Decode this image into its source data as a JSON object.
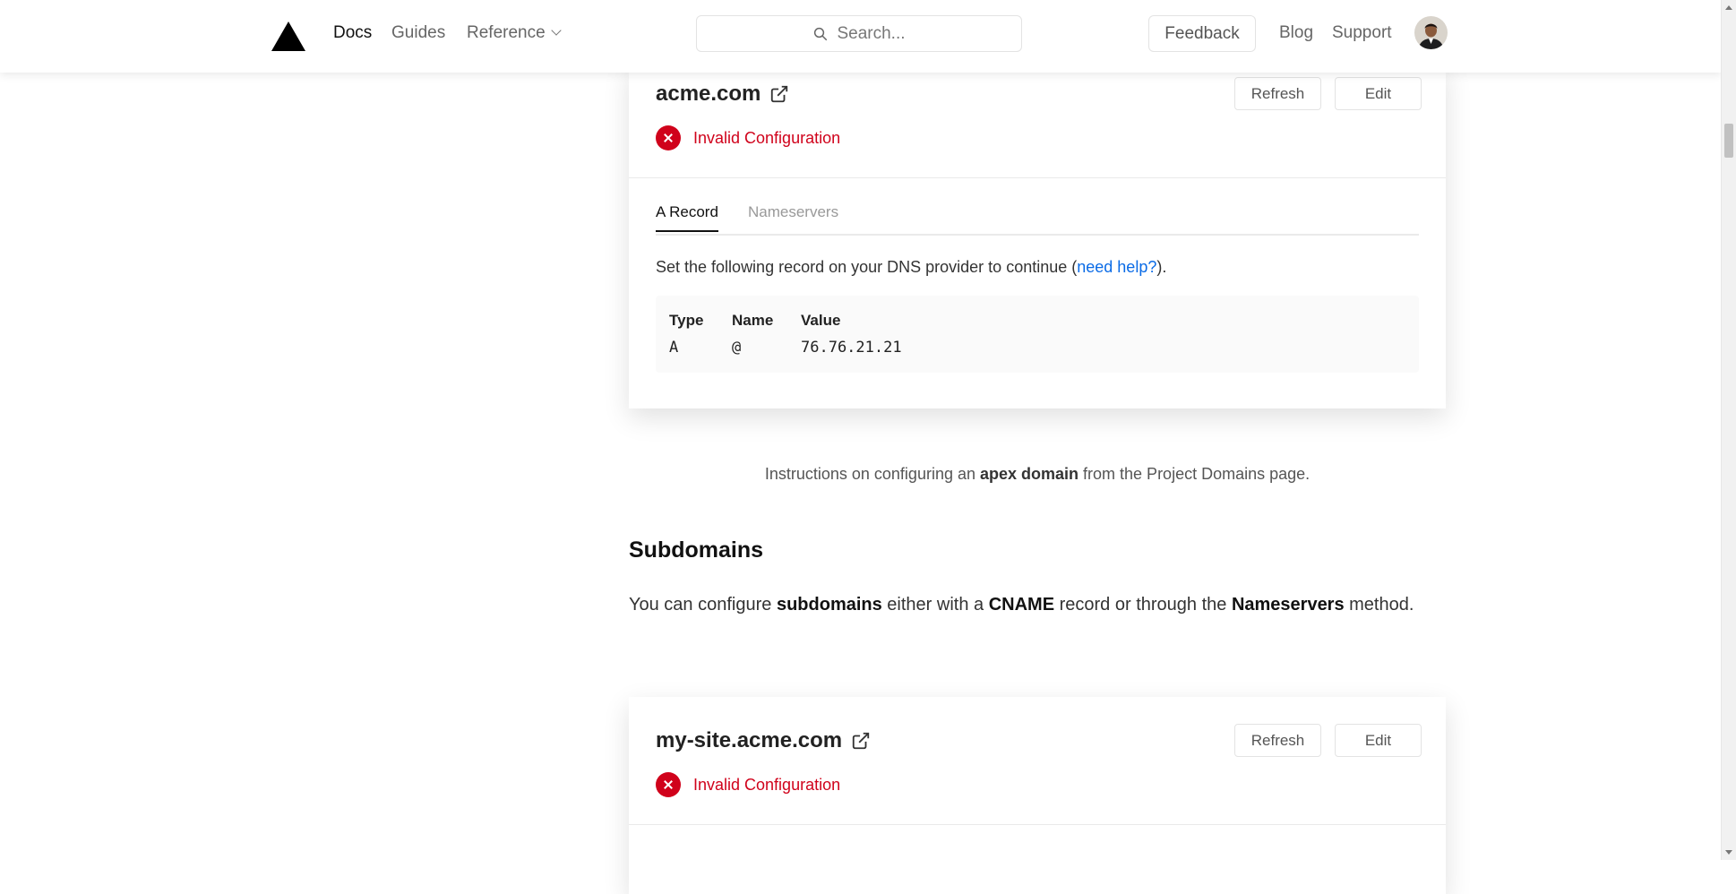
{
  "header": {
    "nav": [
      "Docs",
      "Guides",
      "Reference"
    ],
    "search_placeholder": "Search...",
    "feedback_label": "Feedback",
    "right_links": [
      "Blog",
      "Support"
    ]
  },
  "apex_card": {
    "domain": "acme.com",
    "refresh_label": "Refresh",
    "edit_label": "Edit",
    "status": "Invalid Configuration",
    "tabs": [
      "A Record",
      "Nameservers"
    ],
    "instruction_before": "Set the following record on your DNS provider to continue (",
    "help_link": "need help?",
    "instruction_after": ").",
    "record_headers": [
      "Type",
      "Name",
      "Value"
    ],
    "record_values": [
      "A",
      "@",
      "76.76.21.21"
    ]
  },
  "caption": {
    "before": "Instructions on configuring an ",
    "bold": "apex domain",
    "after": " from the Project Domains page."
  },
  "subdomains": {
    "heading": "Subdomains",
    "p1": "You can configure ",
    "b1": "subdomains",
    "p2": " either with a ",
    "b2": "CNAME",
    "p3": " record or through the ",
    "b3": "Nameservers",
    "p4": " method."
  },
  "sub_card": {
    "domain": "my-site.acme.com",
    "refresh_label": "Refresh",
    "edit_label": "Edit",
    "status": "Invalid Configuration"
  },
  "colors": {
    "error": "#d0021b",
    "link": "#0a6be6"
  }
}
